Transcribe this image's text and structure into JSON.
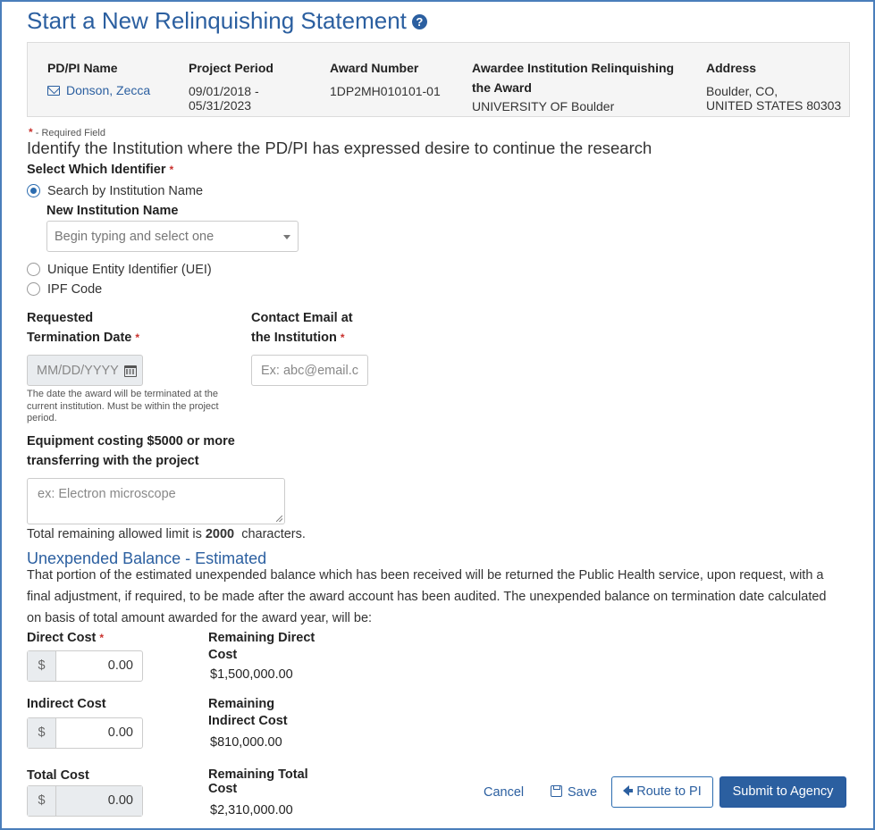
{
  "page": {
    "title": "Start a New Relinquishing Statement",
    "help_icon": "?"
  },
  "summary": {
    "pi_header": "PD/PI Name",
    "pi_name": "Donson, Zecca",
    "period_header": "Project Period",
    "period_start": "09/01/2018 -",
    "period_end": "05/31/2023",
    "award_header": "Award Number",
    "award_number": "1DP2MH010101-01",
    "institution_header_1": "Awardee Institution Relinquishing",
    "institution_header_2": "the Award",
    "institution_name": "UNIVERSITY OF Boulder",
    "address_header": "Address",
    "address_line1": "Boulder, CO,",
    "address_line2": "UNITED STATES 80303"
  },
  "form": {
    "required_marker": "*",
    "required_note": " - Required Field",
    "identify_heading": "Identify the Institution where the PD/PI has expressed desire to continue the research",
    "identifier_label": "Select Which Identifier",
    "radio_options": [
      {
        "label": "Search by Institution Name",
        "selected": true
      },
      {
        "label": "Unique Entity Identifier (UEI)",
        "selected": false
      },
      {
        "label": "IPF Code",
        "selected": false
      }
    ],
    "new_institution_label": "New Institution Name",
    "new_institution_placeholder": "Begin typing and select one",
    "termination_label_1": "Requested",
    "termination_label_2": "Termination  Date",
    "termination_placeholder": "MM/DD/YYYY",
    "termination_help_1": "The date the award  will be terminated at the",
    "termination_help_2": "current institution. Must be within the project",
    "termination_help_3": "period.",
    "email_label_1": "Contact Email at",
    "email_label_2": "the Institution",
    "email_placeholder": "Ex: abc@email.c",
    "equipment_label_1": "Equipment costing $5000 or more",
    "equipment_label_2": "transferring with the project",
    "equipment_placeholder": "ex: Electron microscope",
    "limit_prefix": "Total remaining allowed limit is",
    "limit_value": "2000",
    "limit_suffix": "characters."
  },
  "balance": {
    "section_title": "Unexpended Balance - Estimated",
    "paragraph_1": "That portion of the estimated unexpended balance which has been received will be returned the Public Health service, upon request, with a",
    "paragraph_2": "final adjustment, if required, to be made after the award account has been audited. The unexpended balance on termination date calculated",
    "paragraph_3": "on basis of total amount awarded for the award year, will be:",
    "currency": "$",
    "direct_label": "Direct Cost",
    "direct_value": "0.00",
    "indirect_label": "Indirect Cost",
    "indirect_value": "0.00",
    "total_label": "Total Cost",
    "total_value": "0.00",
    "rem_direct_1": "Remaining Direct",
    "rem_direct_2": "Cost",
    "rem_direct_value": "$1,500,000.00",
    "rem_indirect_1": "Remaining",
    "rem_indirect_2": "Indirect Cost",
    "rem_indirect_value": "$810,000.00",
    "rem_total_1": "Remaining Total",
    "rem_total_2": "Cost",
    "rem_total_value": "$2,310,000.00"
  },
  "actions": {
    "cancel": "Cancel",
    "save": "Save",
    "route": "Route to PI",
    "submit": "Submit to Agency"
  },
  "icons": {
    "help": "help-icon",
    "mail": "mail-icon",
    "calendar": "calendar-icon",
    "save": "save-icon",
    "route": "arrow-left-icon"
  },
  "colors": {
    "accent": "#2b5fa0",
    "required": "#c9302c"
  }
}
